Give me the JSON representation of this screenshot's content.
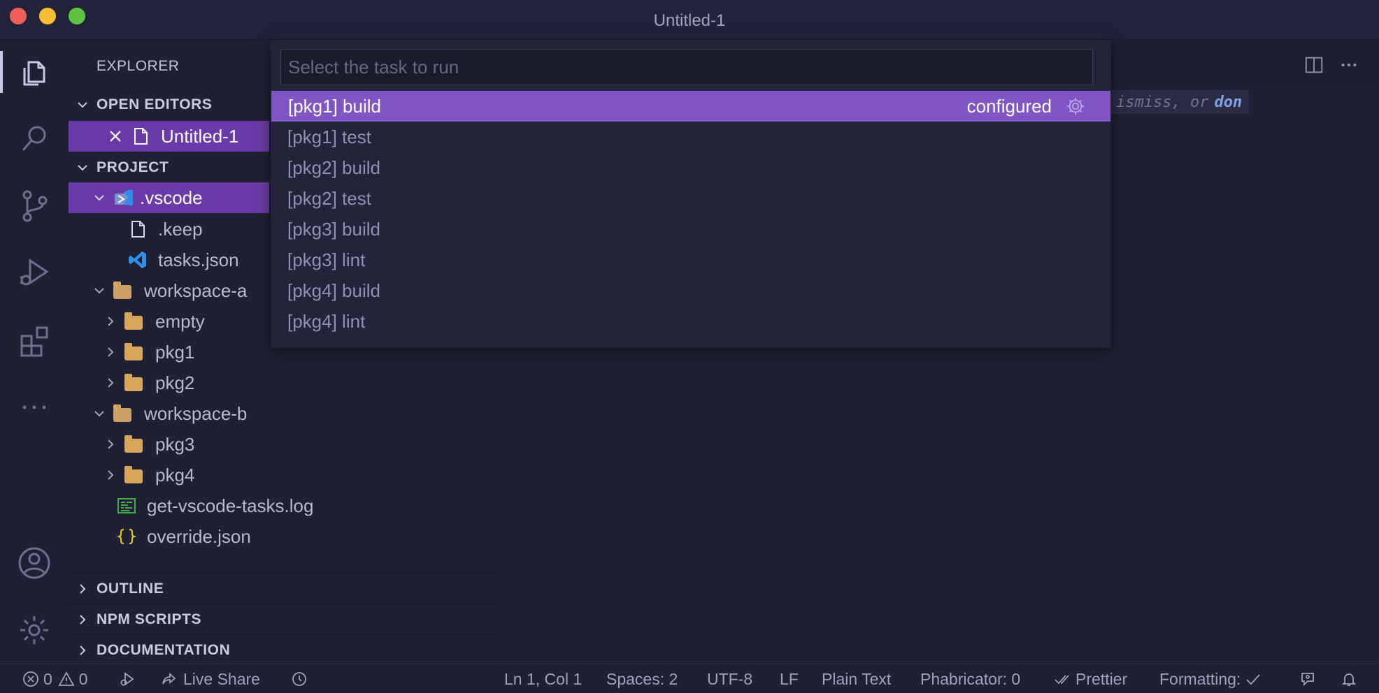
{
  "window": {
    "title": "Untitled-1"
  },
  "sidebar": {
    "header": "EXPLORER",
    "open_editors": {
      "label": "OPEN EDITORS",
      "items": [
        {
          "label": "Untitled-1"
        }
      ]
    },
    "project": {
      "label": "PROJECT",
      "tree": [
        {
          "label": ".vscode"
        },
        {
          "label": ".keep"
        },
        {
          "label": "tasks.json"
        },
        {
          "label": "workspace-a"
        },
        {
          "label": "empty"
        },
        {
          "label": "pkg1"
        },
        {
          "label": "pkg2"
        },
        {
          "label": "workspace-b"
        },
        {
          "label": "pkg3"
        },
        {
          "label": "pkg4"
        },
        {
          "label": "get-vscode-tasks.log"
        },
        {
          "label": "override.json"
        }
      ]
    },
    "bottom_sections": [
      "OUTLINE",
      "NPM SCRIPTS",
      "DOCUMENTATION"
    ]
  },
  "editor": {
    "ghost_text": "ismiss, or",
    "ghost_text_bold": "don"
  },
  "quick_pick": {
    "placeholder": "Select the task to run",
    "value": "",
    "items": [
      {
        "label": "[pkg1] build",
        "description": "configured",
        "active": true
      },
      {
        "label": "[pkg1] test"
      },
      {
        "label": "[pkg2] build"
      },
      {
        "label": "[pkg2] test"
      },
      {
        "label": "[pkg3] build"
      },
      {
        "label": "[pkg3] lint"
      },
      {
        "label": "[pkg4] build"
      },
      {
        "label": "[pkg4] lint"
      }
    ]
  },
  "statusbar": {
    "errors": "0",
    "warnings": "0",
    "live_share": "Live Share",
    "position": "Ln 1, Col 1",
    "spaces": "Spaces: 2",
    "encoding": "UTF-8",
    "eol": "LF",
    "language": "Plain Text",
    "phabricator": "Phabricator: 0",
    "prettier": "Prettier",
    "formatting": "Formatting:"
  },
  "colors": {
    "selection": "#6a3ba8",
    "quickpick_active": "#7f56c4",
    "background": "#1f2033",
    "folder": "#d9a55a"
  }
}
